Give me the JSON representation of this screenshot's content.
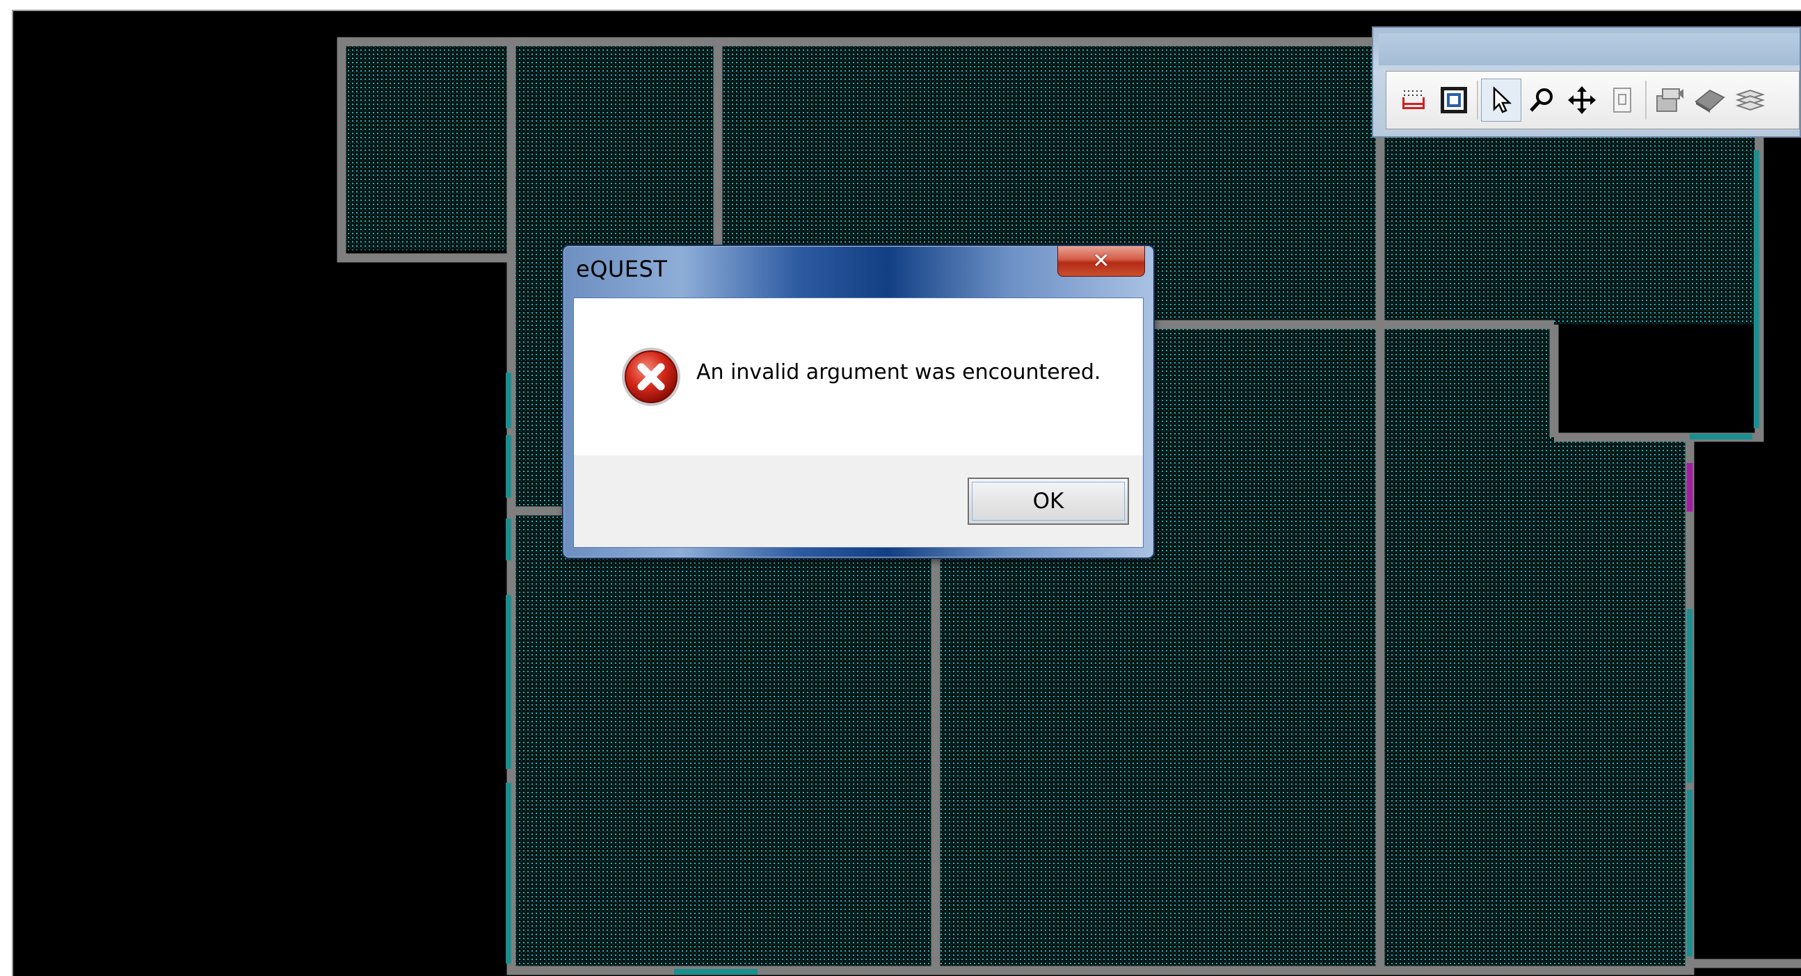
{
  "dialog": {
    "title": "eQUEST",
    "message": "An invalid argument was encountered.",
    "ok_label": "OK",
    "close_glyph": "✕"
  },
  "toolbar": {
    "tools": [
      {
        "icon": "dotted-grid-icon",
        "pressed": false
      },
      {
        "icon": "floor-plan-icon",
        "pressed": false
      },
      {
        "icon": "select-arrow-icon",
        "pressed": true
      },
      {
        "icon": "zoom-icon",
        "pressed": false
      },
      {
        "icon": "pan-move-icon",
        "pressed": false
      },
      {
        "icon": "document-icon",
        "pressed": false
      },
      {
        "icon": "properties-icon",
        "pressed": false
      },
      {
        "icon": "layer-icon",
        "pressed": false
      },
      {
        "icon": "stack-icon",
        "pressed": false
      }
    ]
  },
  "colors": {
    "canvas_background": "#000000",
    "wall": "#7f7f7f",
    "zone_fill_dots": "#1fb8b8",
    "window_highlight": "#1a8f8f",
    "door_highlight": "#a020a0",
    "dialog_frame": "#123f84",
    "close_button": "#c43c21"
  }
}
